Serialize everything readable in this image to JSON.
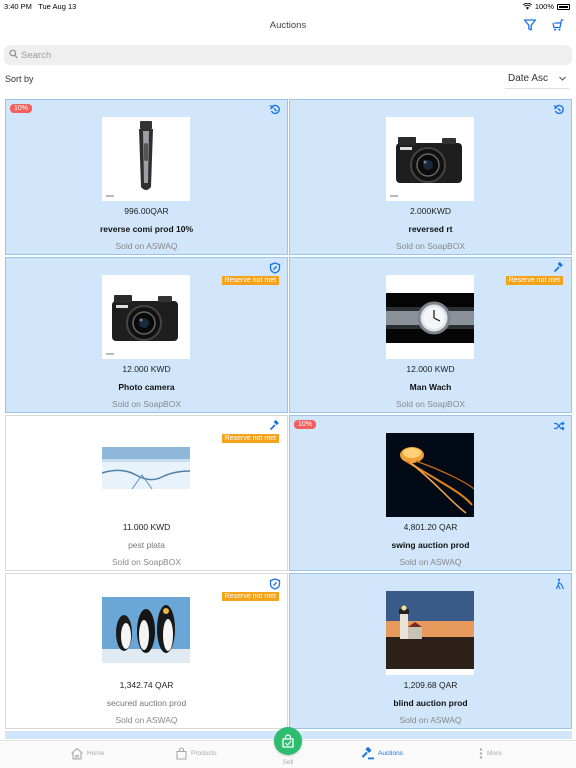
{
  "status": {
    "time": "3:40 PM",
    "date": "Tue Aug 13",
    "battery": "100%"
  },
  "nav": {
    "title": "Auctions",
    "icons": [
      "filter-icon",
      "cart-icon"
    ]
  },
  "search": {
    "placeholder": "Search",
    "value": ""
  },
  "sort": {
    "label": "Sort by",
    "selected": "Date Asc"
  },
  "items": [
    {
      "badge": "10%",
      "reserve": "",
      "type_icon": "reverse-auction-icon",
      "image": "trimmer",
      "price": "996.00QAR",
      "name": "reverse comi prod 10%",
      "name_style": "bold",
      "sold": "Sold on ASWAQ",
      "bg": "blue"
    },
    {
      "badge": "",
      "reserve": "",
      "type_icon": "reverse-auction-icon",
      "image": "camera",
      "price": "2.000KWD",
      "name": "reversed rt",
      "name_style": "bold",
      "sold": "Sold on SoapBOX",
      "bg": "blue"
    },
    {
      "badge": "",
      "reserve": "Reserve not met",
      "type_icon": "secured-auction-icon",
      "image": "camera",
      "price": "12.000 KWD",
      "name": "Photo camera",
      "name_style": "bold",
      "sold": "Sold on SoapBOX",
      "bg": "blue"
    },
    {
      "badge": "",
      "reserve": "Reserve not met",
      "type_icon": "gavel-icon",
      "image": "watch",
      "price": "12.000 KWD",
      "name": "Man Wach",
      "name_style": "bold",
      "sold": "Sold on SoapBOX",
      "bg": "blue"
    },
    {
      "badge": "",
      "reserve": "Reserve not met",
      "type_icon": "gavel-icon",
      "image": "ice",
      "price": "11.000 KWD",
      "name": "pest plata",
      "name_style": "light",
      "sold": "Sold on SoapBOX",
      "bg": "white"
    },
    {
      "badge": "10%",
      "reserve": "",
      "type_icon": "swing-auction-icon",
      "image": "jellyfish",
      "price": "4,801.20 QAR",
      "name": "swing auction prod",
      "name_style": "bold",
      "sold": "Sold on ASWAQ",
      "bg": "blue"
    },
    {
      "badge": "",
      "reserve": "Reserve not met",
      "type_icon": "secured-auction-icon",
      "image": "penguins",
      "price": "1,342.74 QAR",
      "name": "secured auction prod",
      "name_style": "light",
      "sold": "Sold on ASWAQ",
      "bg": "white"
    },
    {
      "badge": "",
      "reserve": "",
      "type_icon": "blind-auction-icon",
      "image": "lighthouse",
      "price": "1,209.68 QAR",
      "name": "blind auction prod",
      "name_style": "bold",
      "sold": "Sold on ASWAQ",
      "bg": "blue"
    }
  ],
  "tabs": [
    {
      "label": "Home",
      "icon": "home-icon",
      "active": false
    },
    {
      "label": "Products",
      "icon": "bag-icon",
      "active": false
    },
    {
      "label": "Sell",
      "icon": "sell-bag-icon",
      "active": false
    },
    {
      "label": "Auctions",
      "icon": "gavel-icon",
      "active": true
    },
    {
      "label": "More",
      "icon": "more-icon",
      "active": false
    }
  ],
  "colors": {
    "accent": "#1a73e8",
    "card_blue": "#d1e6fa",
    "discount": "#f25f5c",
    "reserve": "#f7a21b",
    "sell": "#2dbd6e"
  }
}
